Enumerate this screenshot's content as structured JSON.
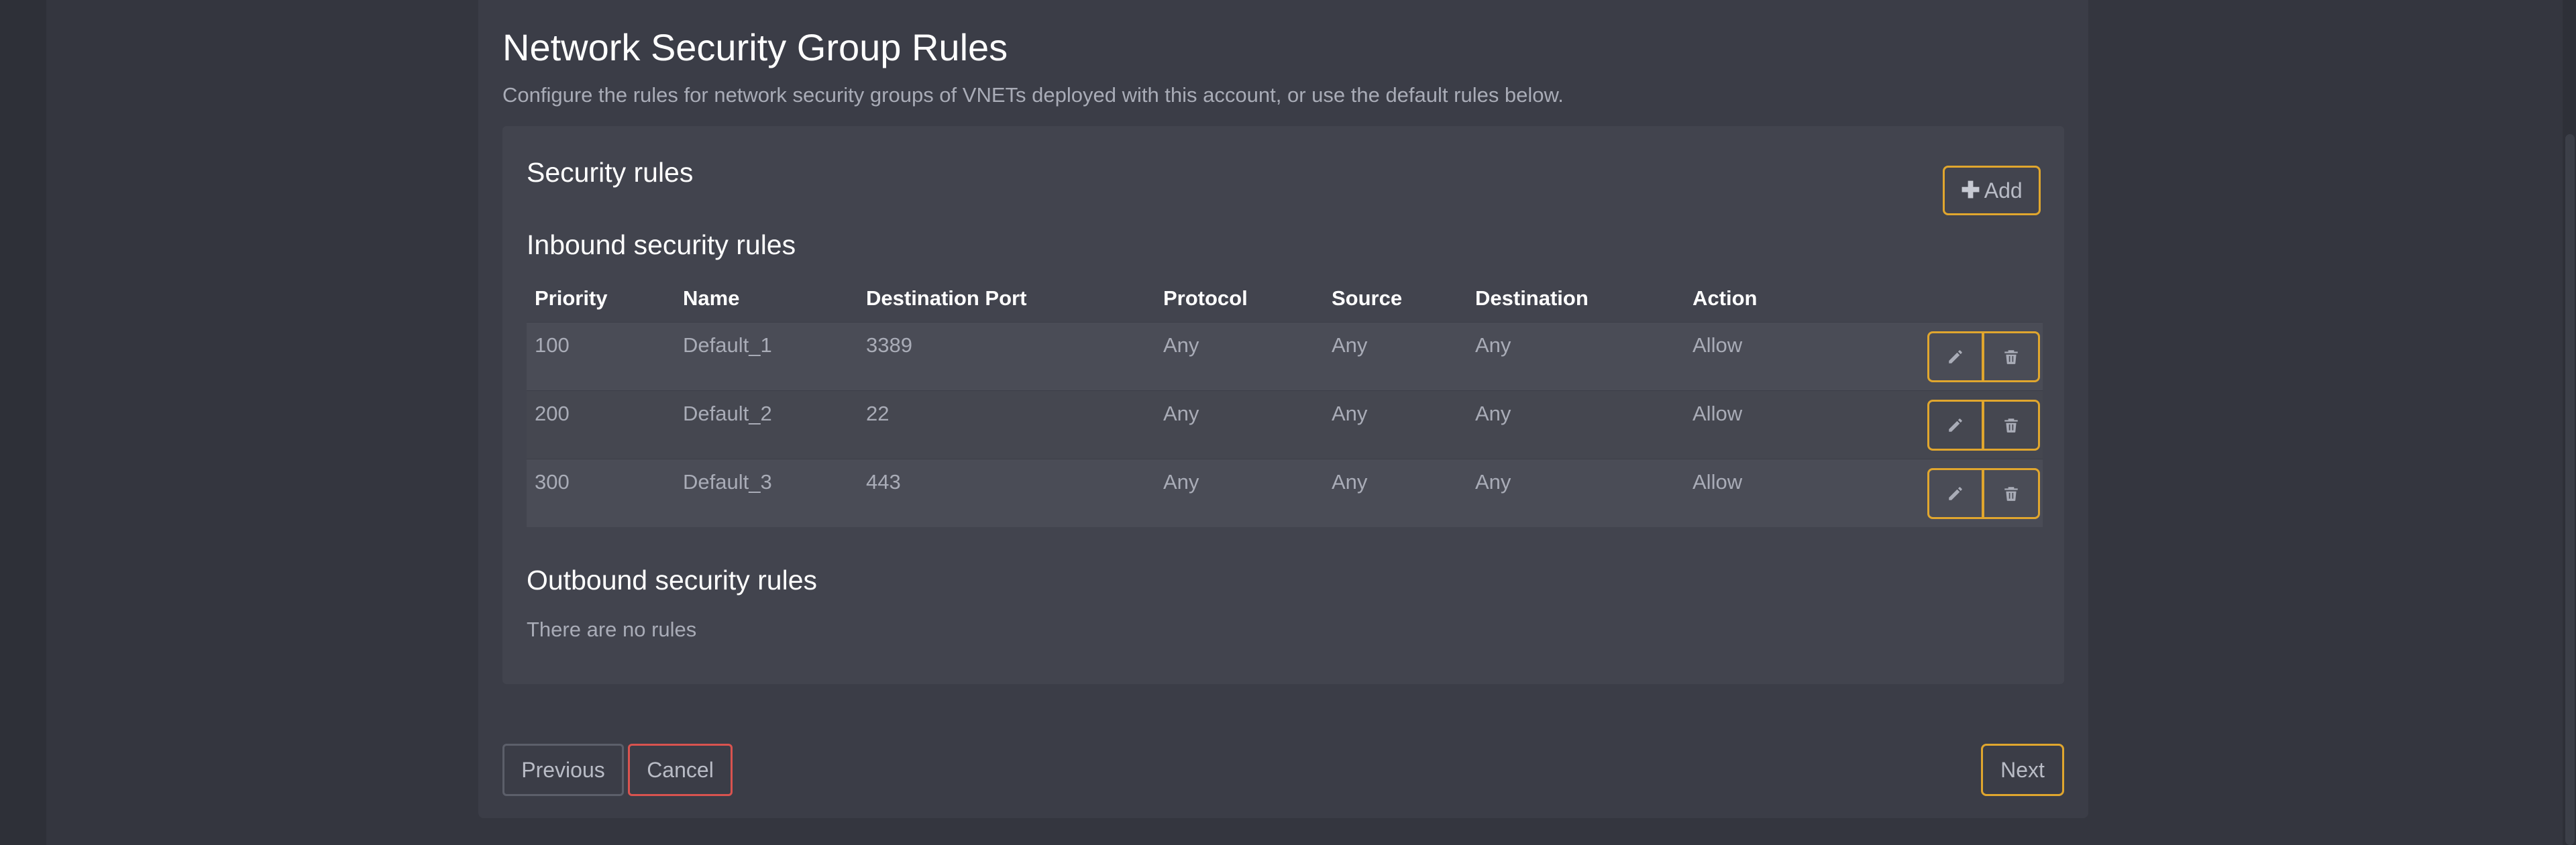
{
  "page": {
    "title": "Network Security Group Rules",
    "description": "Configure the rules for network security groups of VNETs deployed with this account, or use the default rules below."
  },
  "security_rules": {
    "title": "Security rules",
    "add_label": "Add",
    "add_icon": "plus-icon"
  },
  "inbound": {
    "title": "Inbound security rules",
    "columns": [
      "Priority",
      "Name",
      "Destination Port",
      "Protocol",
      "Source",
      "Destination",
      "Action"
    ],
    "rows": [
      {
        "priority": "100",
        "name": "Default_1",
        "port": "3389",
        "protocol": "Any",
        "source": "Any",
        "destination": "Any",
        "action": "Allow"
      },
      {
        "priority": "200",
        "name": "Default_2",
        "port": "22",
        "protocol": "Any",
        "source": "Any",
        "destination": "Any",
        "action": "Allow"
      },
      {
        "priority": "300",
        "name": "Default_3",
        "port": "443",
        "protocol": "Any",
        "source": "Any",
        "destination": "Any",
        "action": "Allow"
      }
    ],
    "row_action_icons": [
      "pencil-icon",
      "trash-icon"
    ]
  },
  "outbound": {
    "title": "Outbound security rules",
    "empty_text": "There are no rules"
  },
  "footer": {
    "previous_label": "Previous",
    "cancel_label": "Cancel",
    "next_label": "Next"
  },
  "colors": {
    "accent": "#e0a62e",
    "danger": "#d9534f",
    "panel_bg": "#3b3d47",
    "card_bg": "#42444e",
    "page_bg": "#2e3038"
  }
}
